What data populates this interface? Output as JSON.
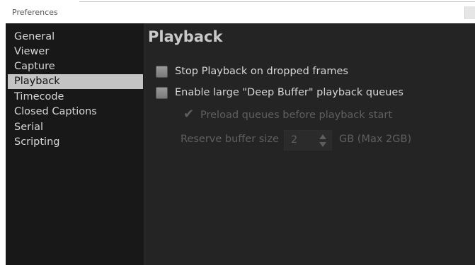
{
  "window": {
    "title": "Preferences"
  },
  "sidebar": {
    "items": [
      {
        "label": "General"
      },
      {
        "label": "Viewer"
      },
      {
        "label": "Capture"
      },
      {
        "label": "Playback"
      },
      {
        "label": "Timecode"
      },
      {
        "label": "Closed Captions"
      },
      {
        "label": "Serial"
      },
      {
        "label": "Scripting"
      }
    ],
    "selected": "Playback"
  },
  "panel": {
    "title": "Playback",
    "options": {
      "stop_on_dropped": {
        "label": "Stop Playback on dropped frames",
        "checked": false,
        "enabled": true
      },
      "deep_buffer": {
        "label": "Enable large \"Deep Buffer\" playback queues",
        "checked": false,
        "enabled": true
      },
      "preload_queues": {
        "label": "Preload queues before playback start",
        "checked": true,
        "enabled": false
      }
    },
    "reserve_buffer": {
      "label": "Reserve buffer size",
      "value": "2",
      "unit_label": "GB (Max 2GB)",
      "enabled": false
    }
  },
  "colors": {
    "background": "#242424",
    "sidebar_background": "#181818",
    "selection": "#c4c4c4",
    "text": "#d6d6d6",
    "disabled_text": "#5f5f5f"
  }
}
